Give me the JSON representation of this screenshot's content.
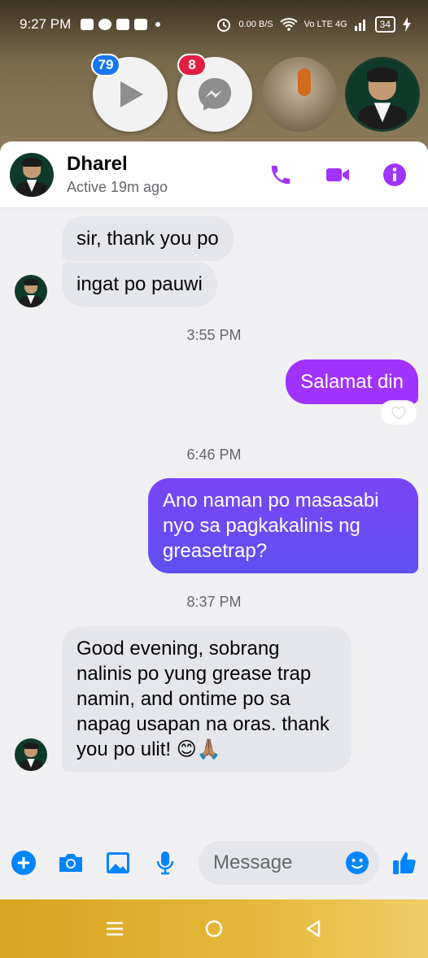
{
  "status_bar": {
    "time": "9:27 PM",
    "net_speed": "0.00 B/S",
    "network": "Vo LTE 4G",
    "battery": "34"
  },
  "chat_heads": [
    {
      "name": "play-store-head",
      "badge": "79",
      "badge_color": "#1877f2"
    },
    {
      "name": "messenger-head",
      "badge": "8",
      "badge_color": "#e41e3f"
    }
  ],
  "header": {
    "name": "Dharel",
    "status": "Active 19m ago"
  },
  "messages": {
    "m1": "sir, thank you po",
    "m2": "ingat po pauwi",
    "t1": "3:55 PM",
    "m3": "Salamat din",
    "t2": "6:46 PM",
    "m4": "Ano naman po masasabi nyo sa pagkakalinis ng greasetrap?",
    "t3": "8:37 PM",
    "m5": "Good evening, sobrang nalinis po yung grease trap namin, and ontime po sa napag usapan na oras. thank you po ulit! 😊🙏🏽"
  },
  "composer": {
    "placeholder": "Message"
  },
  "colors": {
    "accent": "#a033ff",
    "messenger_blue": "#0084ff",
    "outgoing_gradient_start": "#a033ff",
    "outgoing_gradient_end": "#6050f2"
  }
}
